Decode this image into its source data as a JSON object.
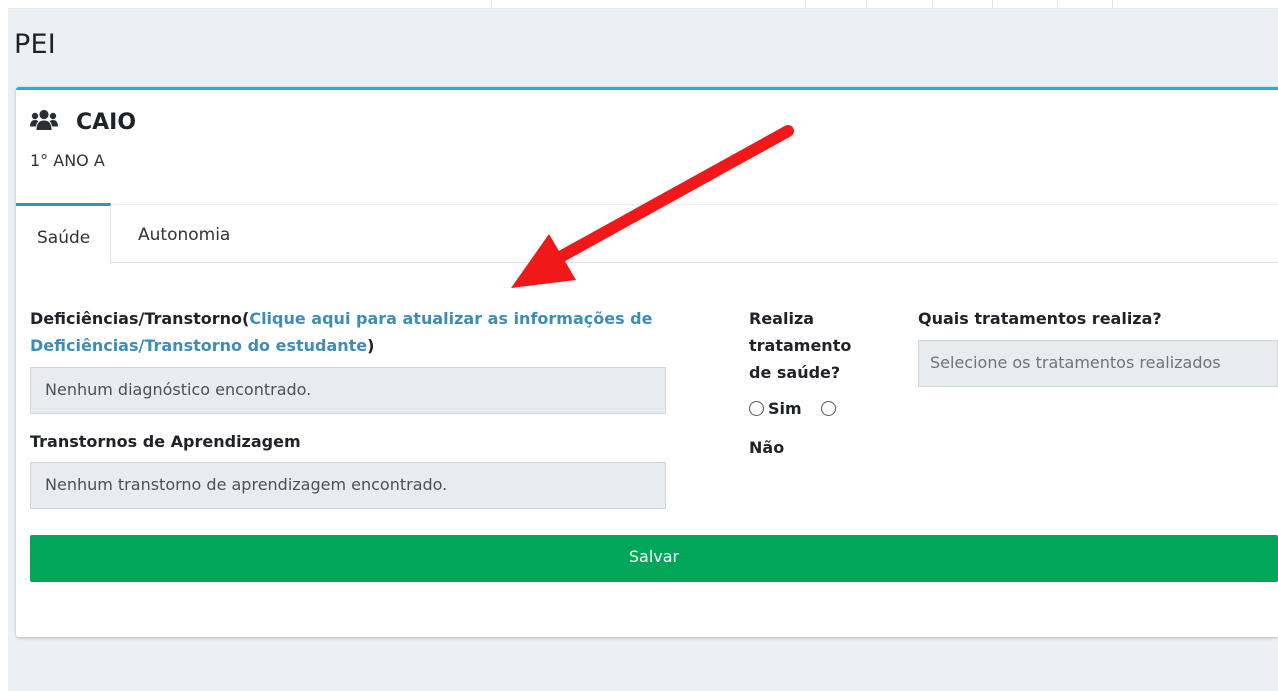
{
  "page": {
    "title": "PEI"
  },
  "student": {
    "name": "CAIO",
    "class": "1° ANO A"
  },
  "tabs": [
    {
      "label": "Saúde",
      "active": true
    },
    {
      "label": "Autonomia",
      "active": false
    }
  ],
  "form": {
    "deficiencias": {
      "label": "Deficiências/Transtorno(",
      "link_text": "Clique aqui para atualizar as informações de Deficiências/Transtorno do estudante",
      "label_close": ")",
      "value": "Nenhum diagnóstico encontrado."
    },
    "transtornos_aprendizagem": {
      "label": "Transtornos de Aprendizagem",
      "value": "Nenhum transtorno de aprendizagem encontrado."
    },
    "realiza_tratamento": {
      "label": "Realiza tratamento de saúde?",
      "options": [
        "Sim",
        "Não"
      ]
    },
    "quais_tratamentos": {
      "label": "Quais tratamentos realiza?",
      "placeholder": "Selecione os tratamentos realizados"
    },
    "save_label": "Salvar"
  },
  "colors": {
    "accent": "#17b3e4",
    "link": "#3c8dbc",
    "save": "#00a65a",
    "annotation_arrow": "#f01818"
  },
  "icons": {
    "student": "users-icon",
    "annotation": "red-arrow-annotation"
  }
}
